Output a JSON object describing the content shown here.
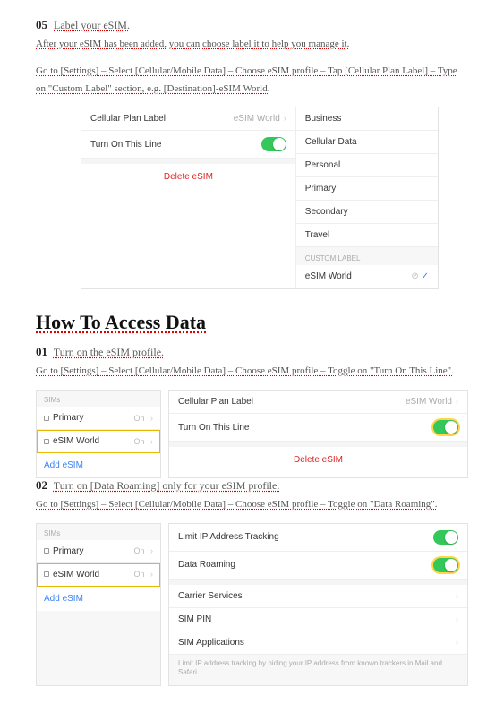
{
  "step05": {
    "num": "05",
    "title": "Label your eSIM.",
    "line1": "After your eSIM has been added, you can choose label it to help you manage it.",
    "line2a": "Go to [Settings] – Select [Cellular/Mobile Data] – Choose eSIM profile – Tap [Cellular Plan Label] – Type",
    "line2b": "on \"Custom Label\" section, e.g. [Destination]-eSIM World."
  },
  "shot05": {
    "cellPlanLabel": "Cellular Plan Label",
    "cellPlanVal": "eSIM World",
    "turnOnLine": "Turn On This Line",
    "deleteEsim": "Delete eSIM",
    "options": [
      "Business",
      "Cellular Data",
      "Personal",
      "Primary",
      "Secondary",
      "Travel"
    ],
    "customLabelHdr": "CUSTOM LABEL",
    "customLabelVal": "eSIM World"
  },
  "heading": "How To Access Data",
  "step01": {
    "num": "01",
    "title": "Turn on the eSIM profile.",
    "line": "Go to [Settings] – Select [Cellular/Mobile Data] – Choose eSIM profile – Toggle on \"Turn On This Line\"."
  },
  "sims": {
    "hdr": "SIMs",
    "primary": "Primary",
    "world": "eSIM World",
    "status": "On",
    "add": "Add eSIM"
  },
  "shot01R": {
    "cellPlanLabel": "Cellular Plan Label",
    "cellPlanVal": "eSIM World",
    "turnOnLine": "Turn On This Line",
    "deleteEsim": "Delete eSIM"
  },
  "step02": {
    "num": "02",
    "title": "Turn on [Data Roaming] only for your eSIM profile.",
    "line": "Go to [Settings] – Select [Cellular/Mobile Data] – Choose eSIM profile – Toggle on \"Data Roaming\"."
  },
  "shot02R": {
    "limitIP": "Limit IP Address Tracking",
    "dataRoaming": "Data Roaming",
    "carrierServices": "Carrier Services",
    "simPin": "SIM PIN",
    "simApps": "SIM Applications",
    "footnote": "Limit IP address tracking by hiding your IP address from known trackers in Mail and Safari."
  }
}
